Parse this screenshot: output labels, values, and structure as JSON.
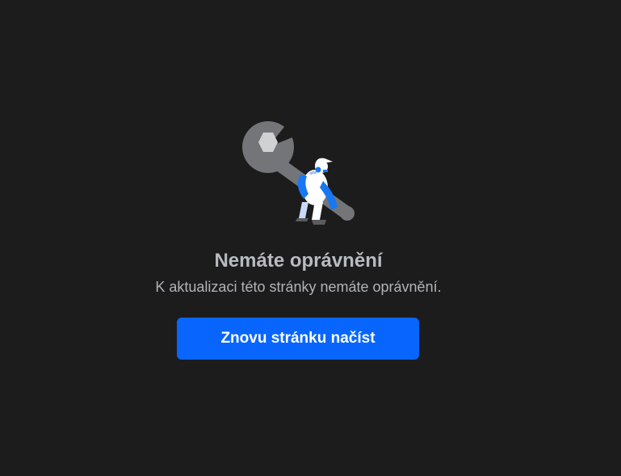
{
  "error": {
    "title": "Nemáte oprávnění",
    "message": "K aktualizaci této stránky nemáte oprávnění.",
    "reload_label": "Znovu stránku načíst"
  },
  "illustration": {
    "icon": "wrench-worker-icon"
  },
  "colors": {
    "background": "#1c1c1d",
    "button": "#0866ff",
    "wrench": "#737578",
    "accent_blue": "#1877f2"
  }
}
